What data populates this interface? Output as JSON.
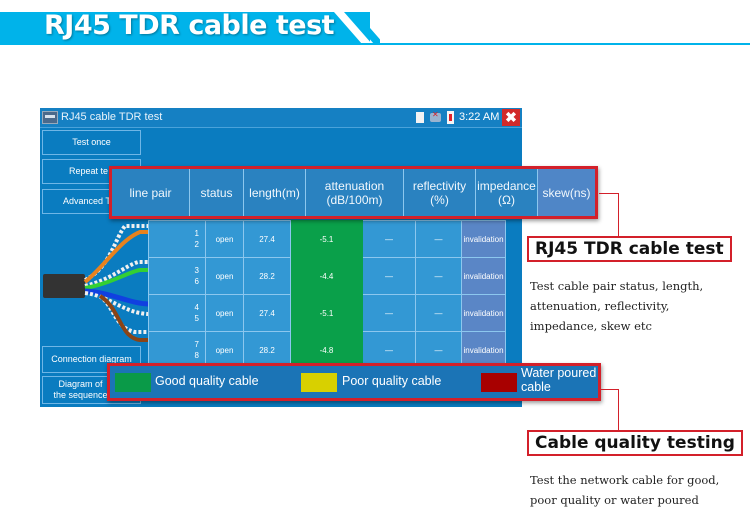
{
  "banner": {
    "title": "RJ45 TDR cable test"
  },
  "app": {
    "title": "RJ45 cable TDR test",
    "status": {
      "time": "3:22 AM"
    },
    "close_label": "✖",
    "sidebar": {
      "buttons": [
        {
          "label": "Test once"
        },
        {
          "label": "Repeat te"
        },
        {
          "label": "Advanced T"
        },
        {
          "label": "Connection diagram"
        },
        {
          "label": "Diagram of the sequence"
        }
      ]
    },
    "table": {
      "headers": [
        "line pair",
        "status",
        "length(m)",
        "attenuation (dB/100m)",
        "reflectivity (%)",
        "impedance (Ω)",
        "skew(ns)"
      ],
      "rows": [
        {
          "pair_top": "1",
          "pair_bottom": "2",
          "status": "open",
          "length": "27.4",
          "attenuation": "-5.1",
          "reflectivity": "—",
          "reflect_pct": "—",
          "impedance": "invalidation"
        },
        {
          "pair_top": "3",
          "pair_bottom": "6",
          "status": "open",
          "length": "28.2",
          "attenuation": "-4.4",
          "reflectivity": "—",
          "reflect_pct": "—",
          "impedance": "invalidation"
        },
        {
          "pair_top": "4",
          "pair_bottom": "5",
          "status": "open",
          "length": "27.4",
          "attenuation": "-5.1",
          "reflectivity": "—",
          "reflect_pct": "—",
          "impedance": "invalidation"
        },
        {
          "pair_top": "7",
          "pair_bottom": "8",
          "status": "open",
          "length": "28.2",
          "attenuation": "-4.8",
          "reflectivity": "—",
          "reflect_pct": "—",
          "impedance": "invalidation"
        }
      ]
    },
    "legend": [
      {
        "label": "Good quality cable",
        "color": "#0a9a48"
      },
      {
        "label": "Poor quality cable",
        "color": "#d8d000"
      },
      {
        "label": "Water poured cable",
        "color": "#a80000"
      }
    ]
  },
  "callouts": [
    {
      "title": "RJ45 TDR cable test",
      "description": "Test cable pair status, length, attenuation, reflectivity, impedance, skew etc"
    },
    {
      "title": "Cable quality testing",
      "description": "Test the network cable for good, poor quality or water poured"
    }
  ],
  "colors": {
    "banner": "#00b3ea",
    "accent_red": "#d3202a",
    "screen_bg": "#0a7cc0",
    "good": "#0a9a48",
    "poor": "#d8d000",
    "water": "#a80000"
  }
}
